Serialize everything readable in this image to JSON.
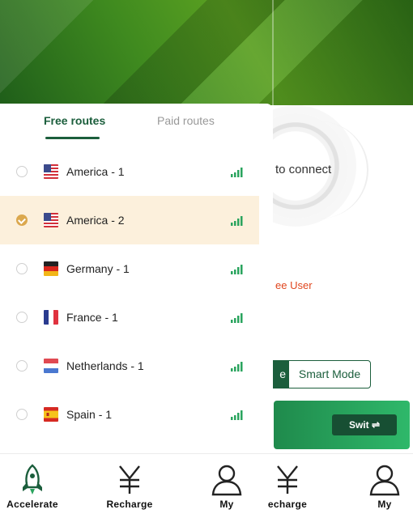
{
  "tabs": {
    "free_label": "Free routes",
    "paid_label": "Paid routes"
  },
  "routes": [
    {
      "name": "America - 1",
      "flag": "us-flag-icon",
      "selected": false
    },
    {
      "name": "America - 2",
      "flag": "us-flag-icon",
      "selected": true
    },
    {
      "name": "Germany - 1",
      "flag": "germany-flag-icon",
      "selected": false
    },
    {
      "name": "France - 1",
      "flag": "france-flag-icon",
      "selected": false
    },
    {
      "name": "Netherlands - 1",
      "flag": "netherlands-flag-icon",
      "selected": false
    },
    {
      "name": "Spain - 1",
      "flag": "spain-flag-icon",
      "selected": false
    }
  ],
  "background": {
    "connect_text": "to connect",
    "free_user_text": "ee User",
    "mode_left_text": "e",
    "mode_right_text": "Smart Mode",
    "switch_label": "Swit ⇌"
  },
  "nav": [
    {
      "label": "Accelerate",
      "icon": "rocket-icon",
      "active": true
    },
    {
      "label": "Recharge",
      "icon": "yen-icon",
      "active": false
    },
    {
      "label": "My",
      "icon": "user-icon",
      "active": false
    },
    {
      "label": "echarge",
      "icon": "yen-icon",
      "active": false
    },
    {
      "label": "My",
      "icon": "user-icon",
      "active": false
    }
  ],
  "colors": {
    "accent": "#1b5e3c",
    "selected_row": "#fcf0dc",
    "radio_checked": "#dba84e",
    "signal": "#2aa45e",
    "warning_text": "#e0461e"
  }
}
